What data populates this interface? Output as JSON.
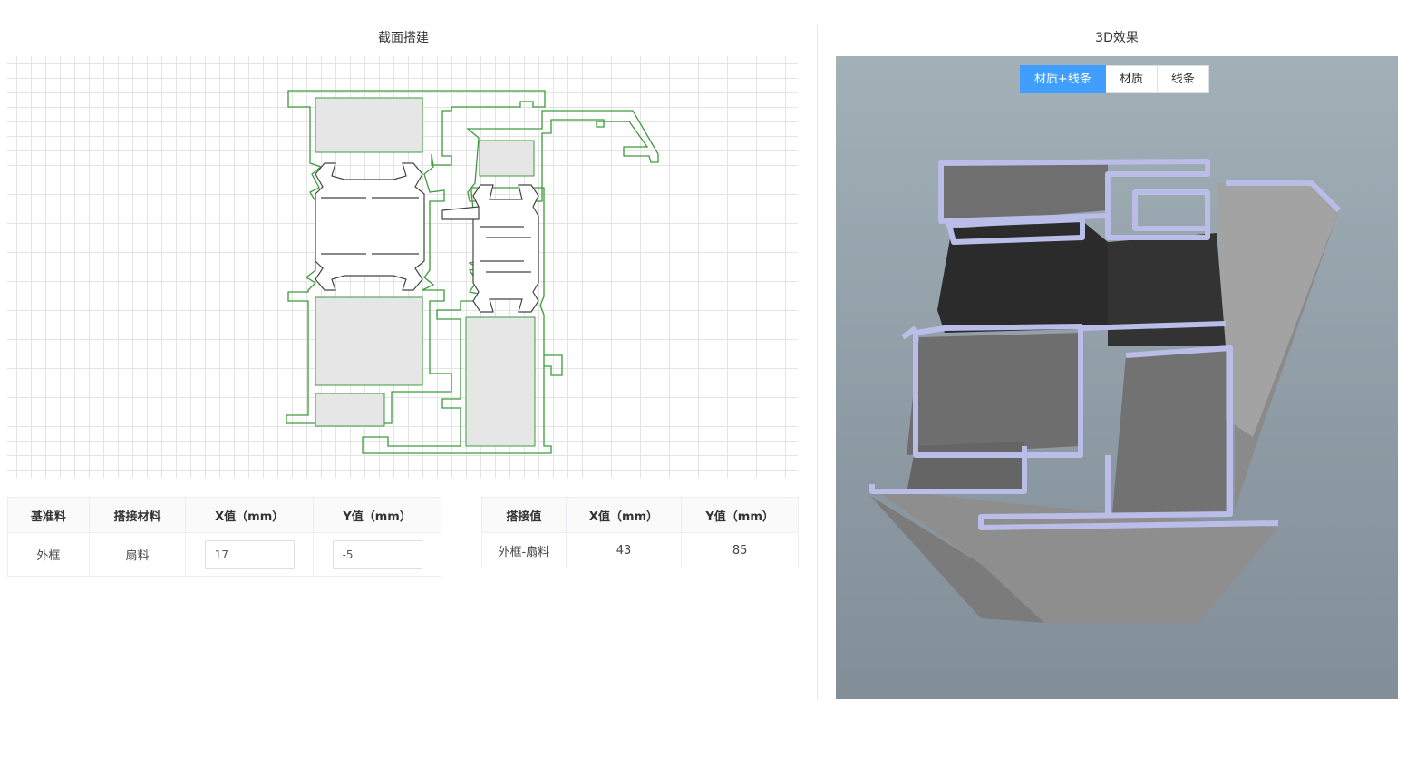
{
  "left_panel": {
    "title": "截面搭建"
  },
  "right_panel": {
    "title": "3D效果",
    "view_modes": [
      "材质+线条",
      "材质",
      "线条"
    ],
    "active_mode": "材质+线条"
  },
  "table_params": {
    "headers": [
      "基准料",
      "搭接材料",
      "X值（mm）",
      "Y值（mm）"
    ],
    "rows": [
      {
        "base": "外框",
        "overlap": "扇料",
        "x_value": "17",
        "y_value": "-5"
      }
    ]
  },
  "table_results": {
    "headers": [
      "搭接值",
      "X值（mm）",
      "Y值（mm）"
    ],
    "rows": [
      {
        "pair": "外框-扇料",
        "x": "43",
        "y": "85"
      }
    ]
  },
  "colors": {
    "outline_green": "#3c9a3c",
    "fill_gray": "#e6e6e6",
    "accent_blue": "#409eff",
    "profile_face": "#b9bde8",
    "profile_body": "#7a7a7a",
    "strip_dark": "#2c2c2c"
  }
}
